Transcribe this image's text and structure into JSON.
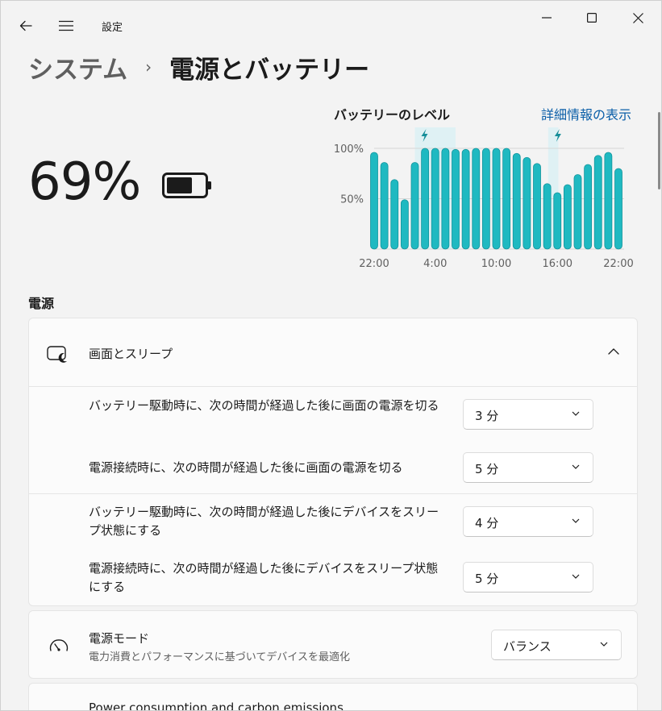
{
  "app": {
    "title": "設定"
  },
  "breadcrumb": {
    "parent": "システム",
    "separator": "›",
    "current": "電源とバッテリー"
  },
  "battery": {
    "percent_text": "69%",
    "level": 0.69
  },
  "chart": {
    "title": "バッテリーのレベル",
    "link": "詳細情報の表示",
    "accent": "#1fb9c1"
  },
  "chart_data": {
    "type": "bar",
    "title": "バッテリーのレベル",
    "ylim": [
      0,
      100
    ],
    "y_tick_labels": [
      "100%",
      "50%"
    ],
    "y_ticks": [
      100,
      50
    ],
    "x_tick_labels": [
      "22:00",
      "4:00",
      "10:00",
      "16:00",
      "22:00"
    ],
    "x_tick_positions": [
      0,
      6,
      12,
      18,
      24
    ],
    "x_range": [
      0,
      24
    ],
    "values": [
      96,
      86,
      69,
      49,
      86,
      100,
      100,
      100,
      99,
      99,
      100,
      100,
      100,
      100,
      95,
      91,
      85,
      65,
      56,
      64,
      74,
      84,
      93,
      96,
      80
    ],
    "charging_ranges": [
      [
        4,
        8
      ],
      [
        17.1,
        18.1
      ]
    ],
    "grid": true
  },
  "section": {
    "title": "電源"
  },
  "screen_sleep": {
    "title": "画面とスリープ",
    "rows": [
      {
        "label": "バッテリー駆動時に、次の時間が経過した後に画面の電源を切る",
        "value": "3 分"
      },
      {
        "label": "電源接続時に、次の時間が経過した後に画面の電源を切る",
        "value": "5 分"
      },
      {
        "label": "バッテリー駆動時に、次の時間が経過した後にデバイスをスリープ状態にする",
        "value": "4 分"
      },
      {
        "label": "電源接続時に、次の時間が経過した後にデバイスをスリープ状態にする",
        "value": "5 分"
      }
    ]
  },
  "power_mode": {
    "title": "電源モード",
    "subtitle": "電力消費とパフォーマンスに基づいてデバイスを最適化",
    "value": "バランス"
  },
  "carbon": {
    "title": "Power consumption and carbon emissions"
  }
}
